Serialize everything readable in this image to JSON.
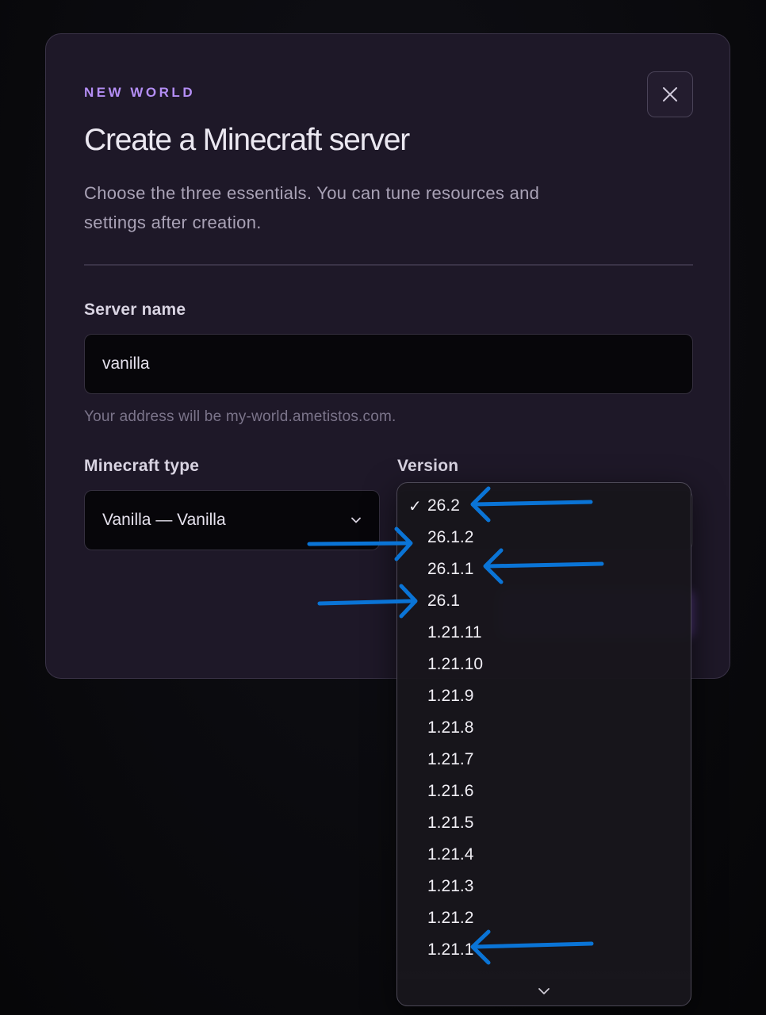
{
  "modal": {
    "eyebrow": "NEW WORLD",
    "title": "Create a Minecraft server",
    "subtitle": "Choose the three essentials. You can tune resources and settings after creation.",
    "close_icon": "close-icon"
  },
  "server_name": {
    "label": "Server name",
    "value": "vanilla",
    "hint": "Your address will be my-world.ametistos.com."
  },
  "minecraft_type": {
    "label": "Minecraft type",
    "selected": "Vanilla — Vanilla"
  },
  "version": {
    "label": "Version",
    "selected": "26.2",
    "check_glyph": "✓",
    "options": [
      "26.2",
      "26.1.2",
      "26.1.1",
      "26.1",
      "1.21.11",
      "1.21.10",
      "1.21.9",
      "1.21.8",
      "1.21.7",
      "1.21.6",
      "1.21.5",
      "1.21.4",
      "1.21.3",
      "1.21.2",
      "1.21.1"
    ]
  },
  "colors": {
    "accent": "#b48ef5",
    "annotation_arrow": "#0a74d6",
    "modal_bg": "#1e1828"
  }
}
